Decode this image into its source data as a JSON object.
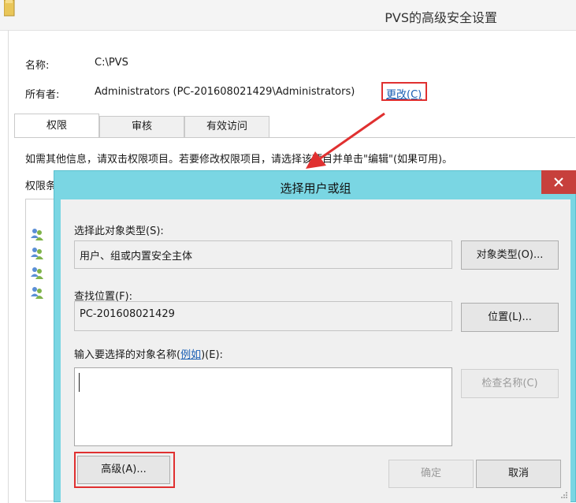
{
  "background_window": {
    "title": "PVS的高级安全设置",
    "name_label": "名称:",
    "name_value": "C:\\PVS",
    "owner_label": "所有者:",
    "owner_value": "Administrators (PC-201608021429\\Administrators)",
    "change_link": "更改(C)",
    "tabs": [
      {
        "label": "权限"
      },
      {
        "label": "审核"
      },
      {
        "label": "有效访问"
      }
    ],
    "info_text": "如需其他信息，请双击权限项目。若要修改权限项目，请选择该项目并单击\"编辑\"(如果可用)。",
    "permissions_label": "权限条"
  },
  "dialog": {
    "title": "选择用户或组",
    "object_type_label": "选择此对象类型(S):",
    "object_type_value": "用户、组或内置安全主体",
    "object_type_button": "对象类型(O)...",
    "location_label": "查找位置(F):",
    "location_value": "PC-201608021429",
    "location_button": "位置(L)...",
    "names_label_prefix": "输入要选择的对象名称(",
    "names_label_link": "例如",
    "names_label_suffix": ")(E):",
    "names_value": "",
    "check_names_button": "检查名称(C)",
    "advanced_button": "高级(A)...",
    "ok_button": "确定",
    "cancel_button": "取消"
  },
  "colors": {
    "dialog_frame": "#7ad6e3",
    "close_button": "#c7403c",
    "highlight_red": "#e03030",
    "link_blue": "#1a5fb4"
  },
  "icons": {
    "folder": "folder-icon",
    "users": "users-icon",
    "close": "close-icon"
  }
}
